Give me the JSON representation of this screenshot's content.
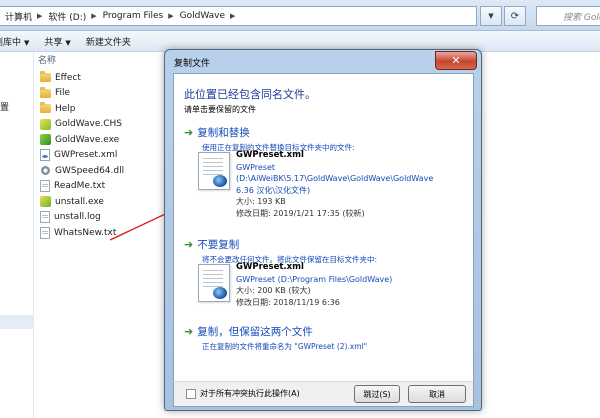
{
  "address": {
    "crumbs": [
      "计算机",
      "软件 (D:)",
      "Program Files",
      "GoldWave"
    ],
    "search_placeholder": "搜索 GoldWave"
  },
  "toolbar": {
    "items": [
      "包含到库中",
      "共享",
      "新建文件夹"
    ]
  },
  "navpane": {
    "label": "位置"
  },
  "filelist": {
    "column_name": "名称",
    "files": [
      {
        "name": "Effect",
        "icon": "folder-icon"
      },
      {
        "name": "File",
        "icon": "folder-icon"
      },
      {
        "name": "Help",
        "icon": "folder-icon"
      },
      {
        "name": "GoldWave.CHS",
        "icon": "file-icon"
      },
      {
        "name": "GoldWave.exe",
        "icon": "exe-icon"
      },
      {
        "name": "GWPreset.xml",
        "icon": "xml-file-icon"
      },
      {
        "name": "GWSpeed64.dll",
        "icon": "dll-gear-icon"
      },
      {
        "name": "ReadMe.txt",
        "icon": "file-icon"
      },
      {
        "name": "unstall.exe",
        "icon": "exe-icon"
      },
      {
        "name": "unstall.log",
        "icon": "file-icon"
      },
      {
        "name": "WhatsNew.txt",
        "icon": "file-icon"
      }
    ]
  },
  "dialog": {
    "title": "复制文件",
    "headline": "此位置已经包含同名文件。",
    "subline": "请单击要保留的文件",
    "option_replace": {
      "title": "复制和替换",
      "desc": "使用正在复制的文件替换目标文件夹中的文件:",
      "file": {
        "name": "GWPreset.xml",
        "line1": "GWPreset",
        "line2": "(D:\\AiWeiBK\\5.17\\GoldWave\\GoldWave\\GoldWave",
        "line3": "6.36 汉化\\汉化文件)",
        "size": "大小: 193 KB",
        "modified": "修改日期: 2019/1/21 17:35 (较新)"
      }
    },
    "option_skip": {
      "title": "不要复制",
      "desc": "将不会更改任何文件。将此文件保留在目标文件夹中:",
      "file": {
        "name": "GWPreset.xml",
        "line1": "GWPreset (D:\\Program Files\\GoldWave)",
        "size": "大小: 200 KB (较大)",
        "modified": "修改日期: 2018/11/19 6:36"
      }
    },
    "option_keep_both": {
      "title": "复制，但保留这两个文件",
      "desc": "正在复制的文件将重命名为 \"GWPreset (2).xml\""
    },
    "checkbox_label": "对于所有冲突执行此操作(A)",
    "skip_button": "跳过(S)",
    "cancel_button": "取消"
  },
  "colors": {
    "link_blue": "#154ab8",
    "arrow_green": "#2e9a2a",
    "annotation_red": "#e02020"
  }
}
